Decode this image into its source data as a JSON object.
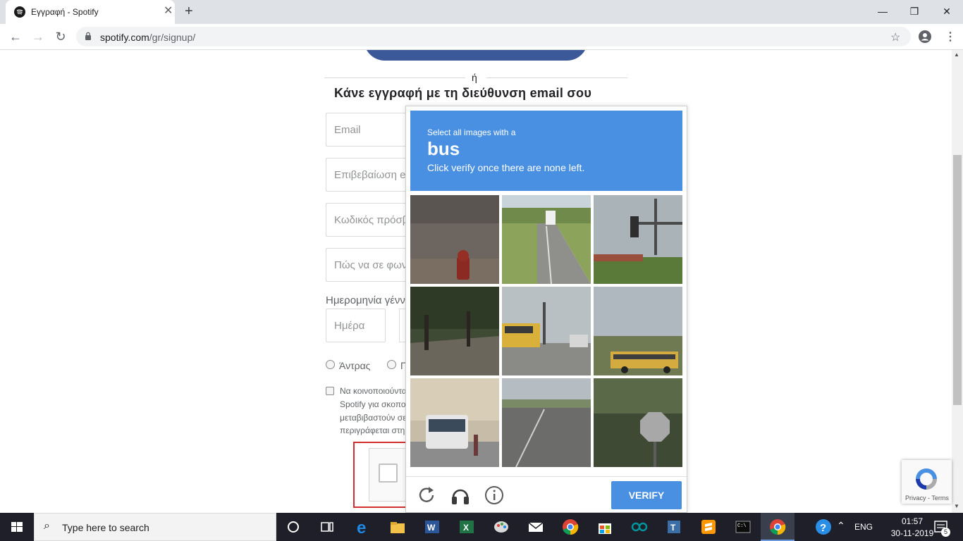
{
  "browser": {
    "tab_title": "Εγγραφή - Spotify",
    "url_domain": "spotify.com",
    "url_path": "/gr/signup/"
  },
  "signup": {
    "or_text": "ή",
    "heading": "Κάνε εγγραφή με τη διεύθυνση email σου",
    "email_placeholder": "Email",
    "confirm_email_placeholder": "Επιβεβαίωση e",
    "password_placeholder": "Κωδικός πρόσβ",
    "name_placeholder": "Πώς να σε φων",
    "dob_label": "Ημερομηνία γένν",
    "day_placeholder": "Ημέρα",
    "gender_male": "Άντρας",
    "gender_female": "Γ",
    "terms_lines": [
      "Να κοινοποιούντα",
      "Spotify για σκοπο",
      "μεταβιβαστούν σε",
      "περιγράφεται στη"
    ]
  },
  "captcha": {
    "instruction_line1": "Select all images with a",
    "keyword": "bus",
    "instruction_line3": "Click verify once there are none left.",
    "verify_label": "VERIFY",
    "badge_text": "Privacy - Terms",
    "tiles": [
      {
        "scene": "fire hydrant on road"
      },
      {
        "scene": "road with truck"
      },
      {
        "scene": "traffic light"
      },
      {
        "scene": "trees over sidewalk"
      },
      {
        "scene": "school bus at intersection"
      },
      {
        "scene": "school bus on grass"
      },
      {
        "scene": "city bus in street"
      },
      {
        "scene": "wide road"
      },
      {
        "scene": "stop sign by trees"
      }
    ]
  },
  "taskbar": {
    "search_placeholder": "Type here to search",
    "lang": "ENG",
    "time": "01:57",
    "date": "30-11-2019",
    "notification_count": "5"
  },
  "colors": {
    "captcha_blue": "#4a90e2",
    "highlight_red": "#d32f2f",
    "facebook_blue": "#3b5998"
  }
}
